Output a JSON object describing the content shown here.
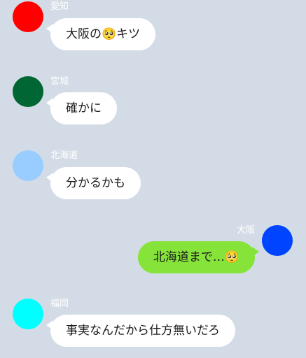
{
  "messages": [
    {
      "sender": "愛知",
      "text": "大阪の🥺キツ",
      "avatar_color": "#ff0000",
      "side": "left"
    },
    {
      "sender": "宮城",
      "text": "確かに",
      "avatar_color": "#006633",
      "side": "left"
    },
    {
      "sender": "北海道",
      "text": "分かるかも",
      "avatar_color": "#99ccff",
      "side": "left"
    },
    {
      "sender": "大阪",
      "text": "北海道まで…🥺",
      "avatar_color": "#0044ff",
      "side": "right"
    },
    {
      "sender": "福岡",
      "text": "事実なんだから仕方無いだろ",
      "avatar_color": "#00ffff",
      "side": "left"
    }
  ],
  "colors": {
    "background": "#d3dce6",
    "incoming_bubble": "#ffffff",
    "outgoing_bubble": "#86e33a",
    "sender_name": "#ffffff"
  }
}
